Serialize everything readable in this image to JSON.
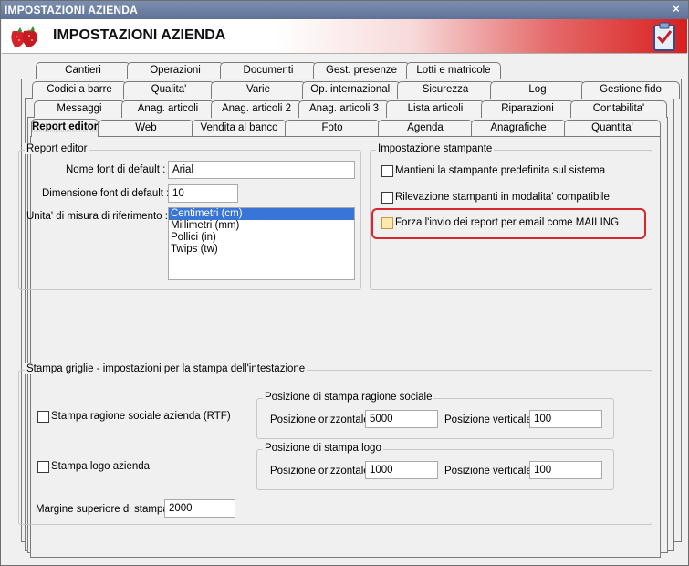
{
  "window": {
    "title": "IMPOSTAZIONI AZIENDA",
    "close_label": "×"
  },
  "header": {
    "title": "IMPOSTAZIONI AZIENDA",
    "logo_icon": "strawberries-icon",
    "action_icon": "clipboard-check-icon"
  },
  "tabs": {
    "row1": [
      "Cantieri",
      "Operazioni",
      "Documenti",
      "Gest. presenze",
      "Lotti e matricole"
    ],
    "row2": [
      "Codici a barre",
      "Qualita'",
      "Varie",
      "Op. internazionali",
      "Sicurezza",
      "Log",
      "Gestione fido"
    ],
    "row3": [
      "Messaggi",
      "Anag. articoli",
      "Anag. articoli 2",
      "Anag. articoli 3",
      "Lista articoli",
      "Riparazioni",
      "Contabilita'"
    ],
    "row4": [
      "Report editor",
      "Web",
      "Vendita al banco",
      "Foto",
      "Agenda",
      "Anagrafiche",
      "Quantita'"
    ]
  },
  "report_editor": {
    "group_title": "Report editor",
    "font_label": "Nome font di default :",
    "font_value": "Arial",
    "size_label": "Dimensione font di default :",
    "size_value": "10",
    "unit_label": "Unita' di misura di riferimento :",
    "unit_options": [
      "Centimetri (cm)",
      "Millimetri (mm)",
      "Pollici (in)",
      "Twips (tw)"
    ],
    "unit_selected": "Centimetri (cm)"
  },
  "printer": {
    "group_title": "Impostazione stampante",
    "opt1": "Mantieni la stampante predefinita sul sistema",
    "opt2": "Rilevazione stampanti in modalita' compatibile",
    "opt3": "Forza l'invio dei report per email come MAILING"
  },
  "grid_print": {
    "group_title": "Stampa griglie - impostazioni per la stampa dell'intestazione",
    "chk_company": "Stampa ragione sociale azienda (RTF)",
    "chk_logo": "Stampa logo azienda",
    "pos_company_title": "Posizione di stampa ragione sociale",
    "pos_logo_title": "Posizione di stampa logo",
    "h_label": "Posizione orizzontale",
    "v_label": "Posizione verticale",
    "company_h": "5000",
    "company_v": "100",
    "logo_h": "1000",
    "logo_v": "100",
    "margin_label": "Margine superiore di stampa",
    "margin_value": "2000"
  }
}
